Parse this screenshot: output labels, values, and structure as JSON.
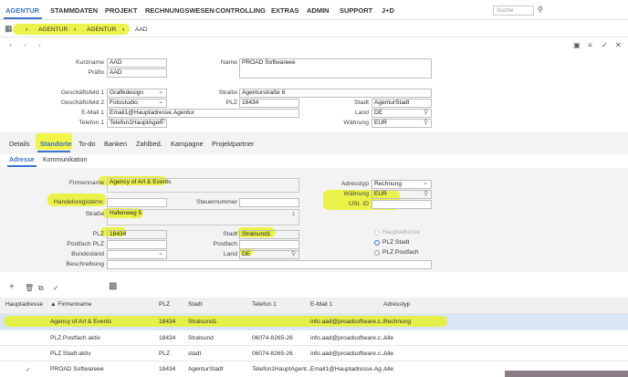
{
  "nav": {
    "items": [
      "AGENTUR",
      "STAMMDATEN",
      "PROJEKT",
      "RECHNUNGSWESEN",
      "CONTROLLING",
      "EXTRAS",
      "ADMIN",
      "SUPPORT",
      "J+D"
    ],
    "search_placeholder": "Suche"
  },
  "breadcrumb": {
    "items": [
      "AGENTUR",
      "AGENTUR",
      "AAD"
    ]
  },
  "header": {
    "kurzname_label": "Kurzname",
    "kurzname": "AAD",
    "praefix_label": "Präfix",
    "praefix": "AAD",
    "name_label": "Name",
    "name": "PROAD Softwareee",
    "gf1_label": "Geschäftsfeld 1",
    "gf1": "Grafikdesign",
    "gf2_label": "Geschäftsfeld 2",
    "gf2": "Fotostudio",
    "email_label": "E-Mail 1",
    "email": "Email1@Hauptadresse.Agentur",
    "tel_label": "Telefon 1",
    "tel": "Telefon1HauptAgen",
    "strasse_label": "Straße",
    "strasse": "Agenturstraße 6",
    "plz_label": "PLZ",
    "plz": "18434",
    "stadt_label": "Stadt",
    "stadt": "AgenturStadt",
    "land_label": "Land",
    "land": "DE",
    "waehrung_label": "Währung",
    "waehrung": "EUR"
  },
  "tabs": [
    "Details",
    "Standorte",
    "To-do",
    "Banken",
    "Zahlbed.",
    "Kampagne",
    "Projektpartner"
  ],
  "subtabs": [
    "Adresse",
    "Kommunikation"
  ],
  "form": {
    "firmenname_label": "Firmenname",
    "firmenname": "Agency of Art & Events",
    "handelsregister_label": "Handelsregisternr.",
    "handelsregister": "",
    "steuernummer_label": "Steuernummer",
    "steuernummer": "",
    "strasse_label": "Straße",
    "strasse": "Hafenweg 5",
    "plz_label": "PLZ",
    "plz": "18434",
    "stadt_label": "Stadt",
    "stadt": "Stralsund1",
    "postfach_plz_label": "Postfach PLZ",
    "postfach_plz": "",
    "postfach_label": "Postfach",
    "postfach": "",
    "bundesland_label": "Bundesland",
    "bundesland": "",
    "land_label": "Land",
    "land": "DE",
    "beschreibung_label": "Beschreibung",
    "beschreibung": "",
    "adresstyp_label": "Adresstyp",
    "adresstyp": "Rechnung",
    "waehrung_label": "Währung",
    "waehrung": "EUR",
    "ustid_label": "USt. ID",
    "ustid": "",
    "radio_haupt": "Hauptadresse",
    "radio_plz": "PLZ Stadt",
    "radio_postfach": "PLZ Postfach"
  },
  "table": {
    "headers": [
      "Hauptadresse",
      "▲ Firmenname",
      "PLZ",
      "Stadt",
      "Telefon 1",
      "E-Mail 1",
      "Adresstyp"
    ],
    "rows": [
      [
        "",
        "Agency of Art & Events",
        "18434",
        "Stralsund1",
        "",
        "info.aad@proadsoftware.c...",
        "Rechnung"
      ],
      [
        "",
        "PLZ Postfach aktiv",
        "18434",
        "Stralsund",
        "06074-8265-26",
        "info.aad@proadsoftware.c...",
        "Alle"
      ],
      [
        "",
        "PLZ Stadt aktiv",
        "PLZ",
        "stadt",
        "06074-8265-26",
        "info.aad@proadsoftware.c...",
        "Alle"
      ],
      [
        "✓",
        "PROAD Softwareee",
        "18434",
        "AgenturStadt",
        "Telefon1HauptAgent...",
        "Email1@Hauptadresse.Ag...",
        "Alle"
      ]
    ]
  }
}
